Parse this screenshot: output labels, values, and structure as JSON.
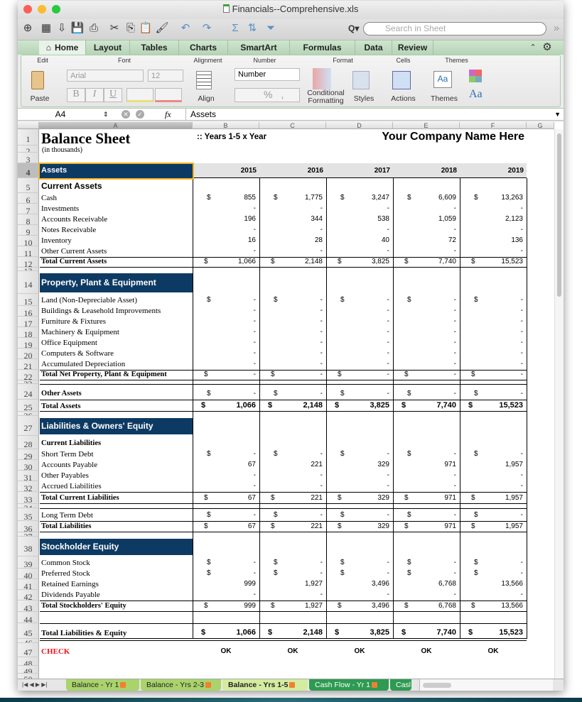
{
  "window": {
    "title": "Financials--Comprehensive.xls"
  },
  "toolbar": {
    "icons": [
      "new-icon",
      "gallery-icon",
      "open-icon",
      "save-icon",
      "print-icon",
      "cut-icon",
      "copy-icon",
      "paste-icon",
      "format-painter-icon",
      "undo-icon",
      "redo-icon",
      "autosum-icon",
      "sort-icon",
      "filter-icon"
    ],
    "search_placeholder": "Search in Sheet"
  },
  "ribbon_tabs": [
    "Home",
    "Layout",
    "Tables",
    "Charts",
    "SmartArt",
    "Formulas",
    "Data",
    "Review"
  ],
  "ribbon": {
    "groups": [
      "Edit",
      "Font",
      "Alignment",
      "Number",
      "Format",
      "Cells",
      "Themes"
    ],
    "paste": "Paste",
    "font_name": "Arial",
    "font_size": "12",
    "bold": "B",
    "italic": "I",
    "underline": "U",
    "align": "Align",
    "number_format": "Number",
    "percent": "%",
    "comma": ",",
    "conditional_formatting": "Conditional Formatting",
    "styles": "Styles",
    "actions": "Actions",
    "themes": "Themes",
    "fonts_aa": "Aa"
  },
  "formula_bar": {
    "cell_ref": "A4",
    "fx": "fx",
    "value": "Assets"
  },
  "columns": [
    "A",
    "B",
    "C",
    "D",
    "E",
    "F",
    "G"
  ],
  "sheet": {
    "title": "Balance Sheet",
    "subtitle": "(in thousands)",
    "period": ":: Years 1-5 x Year",
    "company": "Your Company Name Here",
    "years": [
      "2015",
      "2016",
      "2017",
      "2018",
      "2019"
    ],
    "rows": {
      "4": {
        "label": "Assets",
        "style": "band"
      },
      "5": {
        "label": "Current Assets",
        "style": "section"
      },
      "6": {
        "label": "Cash",
        "style": "item",
        "dollar": true,
        "values": [
          "855",
          "1,775",
          "3,247",
          "6,609",
          "13,263"
        ]
      },
      "7": {
        "label": "Investments",
        "style": "item",
        "values": [
          "-",
          "-",
          "-",
          "-",
          "-"
        ]
      },
      "8": {
        "label": "Accounts Receivable",
        "style": "item",
        "values": [
          "196",
          "344",
          "538",
          "1,059",
          "2,123"
        ]
      },
      "9": {
        "label": "Notes Receivable",
        "style": "item",
        "values": [
          "-",
          "-",
          "-",
          "-",
          "-"
        ]
      },
      "10": {
        "label": "Inventory",
        "style": "item",
        "values": [
          "16",
          "28",
          "40",
          "72",
          "136"
        ]
      },
      "11": {
        "label": "Other Current Assets",
        "style": "item",
        "values": [
          "-",
          "-",
          "-",
          "-",
          "-"
        ]
      },
      "12": {
        "label": "Total Current Assets",
        "style": "total",
        "dollar": true,
        "values": [
          "1,066",
          "2,148",
          "3,825",
          "7,740",
          "15,523"
        ]
      },
      "14": {
        "label": "Property, Plant & Equipment",
        "style": "band"
      },
      "15": {
        "label": "Land (Non-Depreciable Asset)",
        "style": "item",
        "dollar": true,
        "values": [
          "-",
          "-",
          "-",
          "-",
          "-"
        ]
      },
      "16": {
        "label": "Buildings & Leasehold Improvements",
        "style": "item",
        "values": [
          "-",
          "-",
          "-",
          "-",
          "-"
        ]
      },
      "17": {
        "label": "Furniture & Fixtures",
        "style": "item",
        "values": [
          "-",
          "-",
          "-",
          "-",
          "-"
        ]
      },
      "18": {
        "label": "Machinery & Equipment",
        "style": "item",
        "values": [
          "-",
          "-",
          "-",
          "-",
          "-"
        ]
      },
      "19": {
        "label": "Office Equipment",
        "style": "item",
        "values": [
          "-",
          "-",
          "-",
          "-",
          "-"
        ]
      },
      "20": {
        "label": "Computers & Software",
        "style": "item",
        "values": [
          "-",
          "-",
          "-",
          "-",
          "-"
        ]
      },
      "21": {
        "label": "Accumulated Depreciation",
        "style": "item",
        "values": [
          "-",
          "-",
          "-",
          "-",
          "-"
        ]
      },
      "22": {
        "label": "Total Net Property, Plant & Equipment",
        "style": "total",
        "dollar": true,
        "values": [
          "-",
          "-",
          "-",
          "-",
          "-"
        ]
      },
      "24": {
        "label": "Other Assets",
        "style": "totalb",
        "dollar": true,
        "values": [
          "-",
          "-",
          "-",
          "-",
          "-"
        ]
      },
      "25": {
        "label": "Total Assets",
        "style": "grand",
        "dollar": true,
        "values": [
          "1,066",
          "2,148",
          "3,825",
          "7,740",
          "15,523"
        ]
      },
      "27": {
        "label": "Liabilities & Owners' Equity",
        "style": "band"
      },
      "28": {
        "label": "Current Liabilities",
        "style": "subhead"
      },
      "29": {
        "label": "Short Term Debt",
        "style": "item",
        "dollar": true,
        "values": [
          "-",
          "-",
          "-",
          "-",
          "-"
        ]
      },
      "30": {
        "label": "Accounts Payable",
        "style": "item",
        "values": [
          "67",
          "221",
          "329",
          "971",
          "1,957"
        ]
      },
      "31": {
        "label": "Other Payables",
        "style": "item",
        "values": [
          "-",
          "-",
          "-",
          "-",
          "-"
        ]
      },
      "32": {
        "label": "Accrued Liabilities",
        "style": "item",
        "values": [
          "-",
          "-",
          "-",
          "-",
          "-"
        ]
      },
      "33": {
        "label": "Total Current Liabilities",
        "style": "total",
        "dollar": true,
        "values": [
          "67",
          "221",
          "329",
          "971",
          "1,957"
        ]
      },
      "35": {
        "label": "Long Term Debt",
        "style": "itemtop",
        "dollar": true,
        "values": [
          "-",
          "-",
          "-",
          "-",
          "-"
        ]
      },
      "36": {
        "label": "Total Liabilities",
        "style": "total",
        "dollar": true,
        "values": [
          "67",
          "221",
          "329",
          "971",
          "1,957"
        ]
      },
      "38": {
        "label": "Stockholder Equity",
        "style": "band"
      },
      "39": {
        "label": "Common Stock",
        "style": "item",
        "dollar": true,
        "values": [
          "-",
          "-",
          "-",
          "-",
          "-"
        ]
      },
      "40": {
        "label": "Preferred Stock",
        "style": "item",
        "dollar": true,
        "values": [
          "-",
          "-",
          "-",
          "-",
          "-"
        ]
      },
      "41": {
        "label": "Retained Earnings",
        "style": "item",
        "values": [
          "999",
          "1,927",
          "3,496",
          "6,768",
          "13,566"
        ]
      },
      "42": {
        "label": "Dividends Payable",
        "style": "item",
        "values": [
          "-",
          "-",
          "-",
          "-",
          "-"
        ]
      },
      "43": {
        "label": "Total Stockholders' Equity",
        "style": "total",
        "dollar": true,
        "values": [
          "999",
          "1,927",
          "3,496",
          "6,768",
          "13,566"
        ]
      },
      "45": {
        "label": "Total Liabilities & Equity",
        "style": "grand",
        "dollar": true,
        "values": [
          "1,066",
          "2,148",
          "3,825",
          "7,740",
          "15,523"
        ]
      },
      "47": {
        "label": "CHECK",
        "style": "check",
        "values": [
          "OK",
          "OK",
          "OK",
          "OK",
          "OK"
        ]
      }
    },
    "currency_symbol": "$"
  },
  "sheet_tabs": [
    {
      "label": "Balance - Yr 1",
      "color": "#a9d36b"
    },
    {
      "label": "Balance - Yrs 2-3",
      "color": "#a9d36b"
    },
    {
      "label": "Balance - Yrs 1-5",
      "color": "#d4ec9f",
      "active": true
    },
    {
      "label": "Cash Flow - Yr 1",
      "color": "#2e9a52"
    },
    {
      "label": "Casl",
      "color": "#2e9a52"
    }
  ],
  "colors": {
    "band": "#0d3a63",
    "check": "#e8141c",
    "ribbon": "#b6d4b6",
    "selection": "#f5b324"
  }
}
